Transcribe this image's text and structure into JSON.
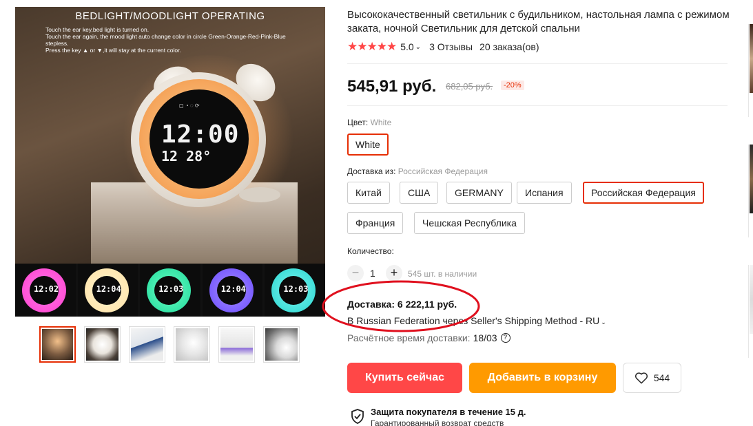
{
  "gallery": {
    "banner": "BEDLIGHT/MOODLIGHT OPERATING",
    "notes": [
      "Touch the ear key,bed light is turned on.",
      "Touch the ear again, the mood light auto change color in circle Green-Orange-Red-Pink-Blue",
      "stepless.",
      "Press the key ▲ or ▼,it will stay at the current color."
    ],
    "display_time": "12:00",
    "display_sub": "12 28°",
    "strip_times": [
      "12:02",
      "12:04",
      "12:03",
      "12:04",
      "12:03"
    ],
    "strip_colors": [
      "#ff3fd0",
      "#ffe3a6",
      "#1fd99a",
      "#6b4cff",
      "#27d6d0"
    ]
  },
  "product": {
    "title": "Высококачественный светильник с будильником, настольная лампа с режимом заката, ночной Светильник для детской спальни",
    "stars": "★★★★★",
    "rating": "5.0",
    "reviews": "3 Отзывы",
    "orders": "20 заказа(ов)",
    "price": "545,91 руб.",
    "old_price": "682,05 руб.",
    "discount": "-20%"
  },
  "color": {
    "label": "Цвет:",
    "value": "White",
    "options": [
      "White"
    ]
  },
  "ship_from": {
    "label": "Доставка из:",
    "value": "Российская Федерация",
    "options": [
      "Китай",
      "США",
      "GERMANY",
      "Испания",
      "Российская Федерация",
      "Франция",
      "Чешская Республика"
    ]
  },
  "quantity": {
    "label": "Количество:",
    "minus": "−",
    "plus": "+",
    "value": "1",
    "stock": "545 шт. в наличии"
  },
  "shipping": {
    "title": "Доставка: 6 222,11 руб.",
    "route": "В Russian Federation через Seller's Shipping Method - RU",
    "time_label": "Расчётное время доставки:",
    "time_value": "18/03",
    "help": "?"
  },
  "actions": {
    "buy": "Купить сейчас",
    "cart": "Добавить в корзину",
    "wishlist_count": "544"
  },
  "protection": {
    "title": "Защита покупателя в течение 15 д.",
    "subtitle": "Гарантированный возврат средств"
  },
  "colors": {
    "accent": "#e62e04",
    "buy": "#ff4747",
    "cart": "#ff9a00",
    "annotation": "#e0101e"
  }
}
